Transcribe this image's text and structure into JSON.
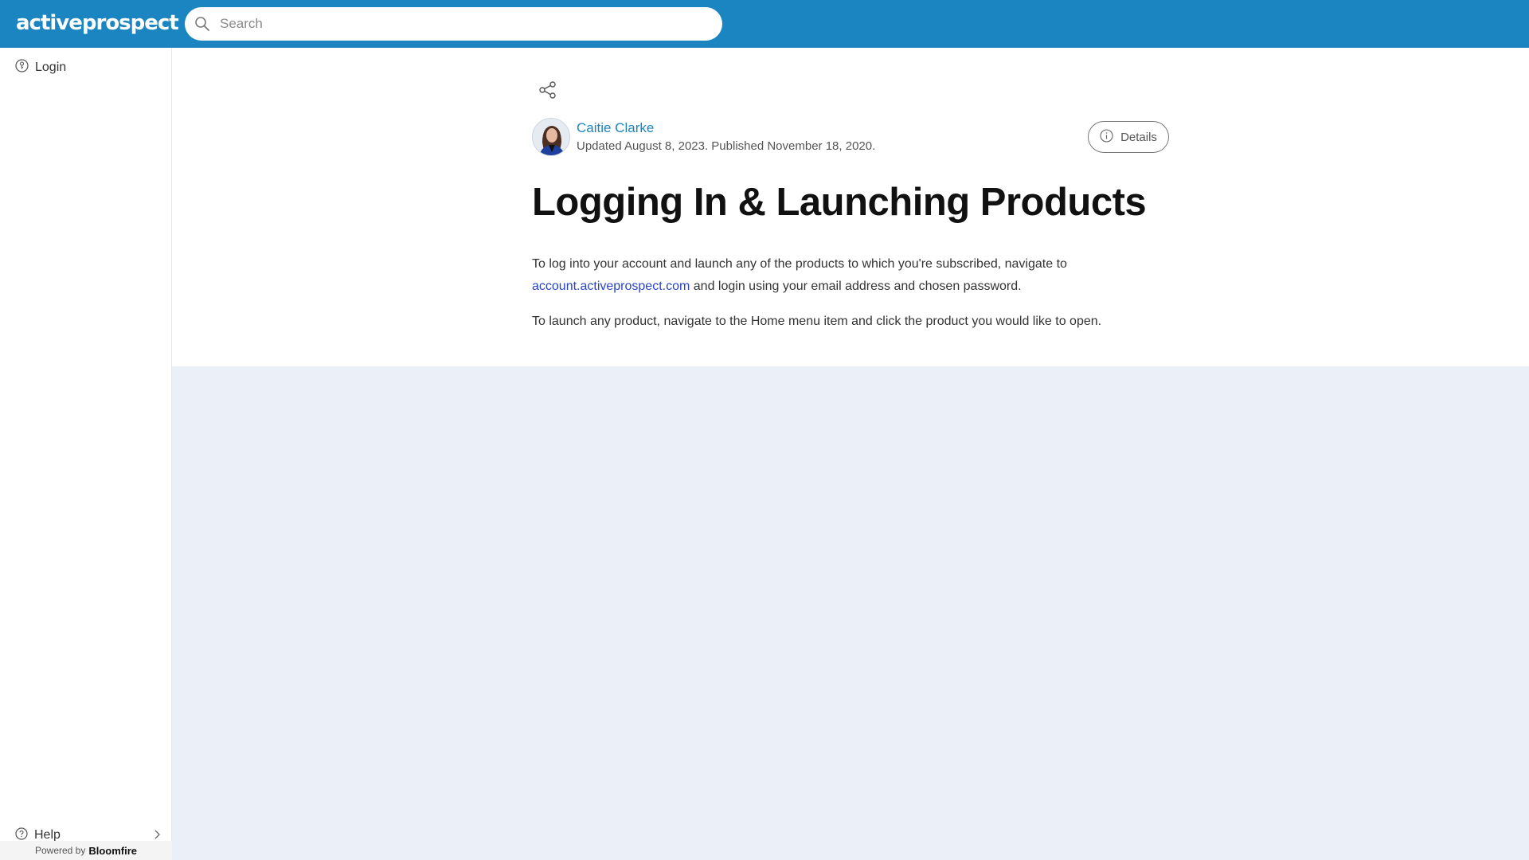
{
  "header": {
    "logo_text": "activeprospect",
    "search_placeholder": "Search",
    "bg_color": "#1b85c1"
  },
  "sidebar": {
    "items": [
      {
        "label": "Login",
        "icon": "key-circle-icon"
      }
    ],
    "help_label": "Help",
    "powered_by": "Powered by",
    "brand": "Bloomfire"
  },
  "article": {
    "author": "Caitie Clarke",
    "dates": "Updated August 8, 2023. Published November 18, 2020.",
    "details_label": "Details",
    "title": "Logging In & Launching Products",
    "para1_text": "To log into your account and launch any of the products to which you're subscribed, navigate to",
    "link_text": "account.activeprospect.com",
    "para1_rest": " and login using your email address and chosen password.",
    "para2": "To launch any product, navigate to the Home menu item and click the product you would like to open."
  },
  "colors": {
    "accent": "#1b85c1",
    "link": "#2a44c9",
    "content_bg": "#ebeff7"
  }
}
